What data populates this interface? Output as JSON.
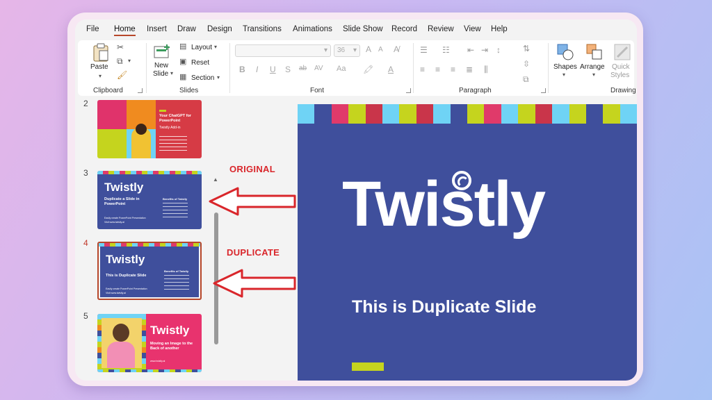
{
  "menu": {
    "tabs": [
      "File",
      "Home",
      "Insert",
      "Draw",
      "Design",
      "Transitions",
      "Animations",
      "Slide Show",
      "Record",
      "Review",
      "View",
      "Help"
    ],
    "active": "Home"
  },
  "ribbon": {
    "clipboard": {
      "group": "Clipboard",
      "paste": "Paste"
    },
    "slides": {
      "group": "Slides",
      "new_slide_1": "New",
      "new_slide_2": "Slide",
      "layout": "Layout",
      "reset": "Reset",
      "section": "Section"
    },
    "font": {
      "group": "Font",
      "size": "36",
      "bold": "B",
      "italic": "I",
      "underline": "U",
      "shadow": "S",
      "strike": "ab",
      "spacing": "AV",
      "case": "Aa",
      "grow": "A",
      "shrink": "A"
    },
    "paragraph": {
      "group": "Paragraph"
    },
    "drawing": {
      "group": "Drawing",
      "shapes": "Shapes",
      "arrange": "Arrange",
      "quick_1": "Quick",
      "quick_2": "Styles"
    }
  },
  "thumbnails": [
    {
      "num": "2",
      "title": "Your ChatGPT for PowerPoint",
      "subtitle": "Twistly Add-in"
    },
    {
      "num": "3",
      "logo": "Twistly",
      "title": "Duplicate a Slide in PowerPoint",
      "side": "Benefits of Twistly",
      "footer": "Easily create PowerPoint Presentation",
      "link": "Visit www.twistly.ai"
    },
    {
      "num": "4",
      "logo": "Twistly",
      "title": "This is Duplicate Slide",
      "side": "Benefits of Twistly",
      "footer": "Easily create PowerPoint Presentation",
      "link": "Visit www.twistly.ai"
    },
    {
      "num": "5",
      "logo": "Twistly",
      "title": "Moving an Image to the Back of another",
      "link": "www.twistly.ai"
    }
  ],
  "annotations": {
    "original": "ORIGINAL",
    "duplicate": "DUPLICATE"
  },
  "main_slide": {
    "logo": "Twistly",
    "subtitle": "This is Duplicate Slide"
  },
  "colors": {
    "slide_bg": "#3f4f9c",
    "accent_red": "#d9262b",
    "strip": [
      "#6fd3f5",
      "#3f4f9c",
      "#e03a6a",
      "#c5d41e",
      "#c9354a",
      "#6fd3f5",
      "#c5d41e",
      "#c9354a",
      "#6fd3f5",
      "#3f4f9c",
      "#c5d41e",
      "#e03a6a",
      "#6fd3f5",
      "#c5d41e",
      "#c9354a",
      "#6fd3f5",
      "#c5d41e",
      "#3f4f9c",
      "#c5d41e",
      "#6fd3f5"
    ]
  }
}
